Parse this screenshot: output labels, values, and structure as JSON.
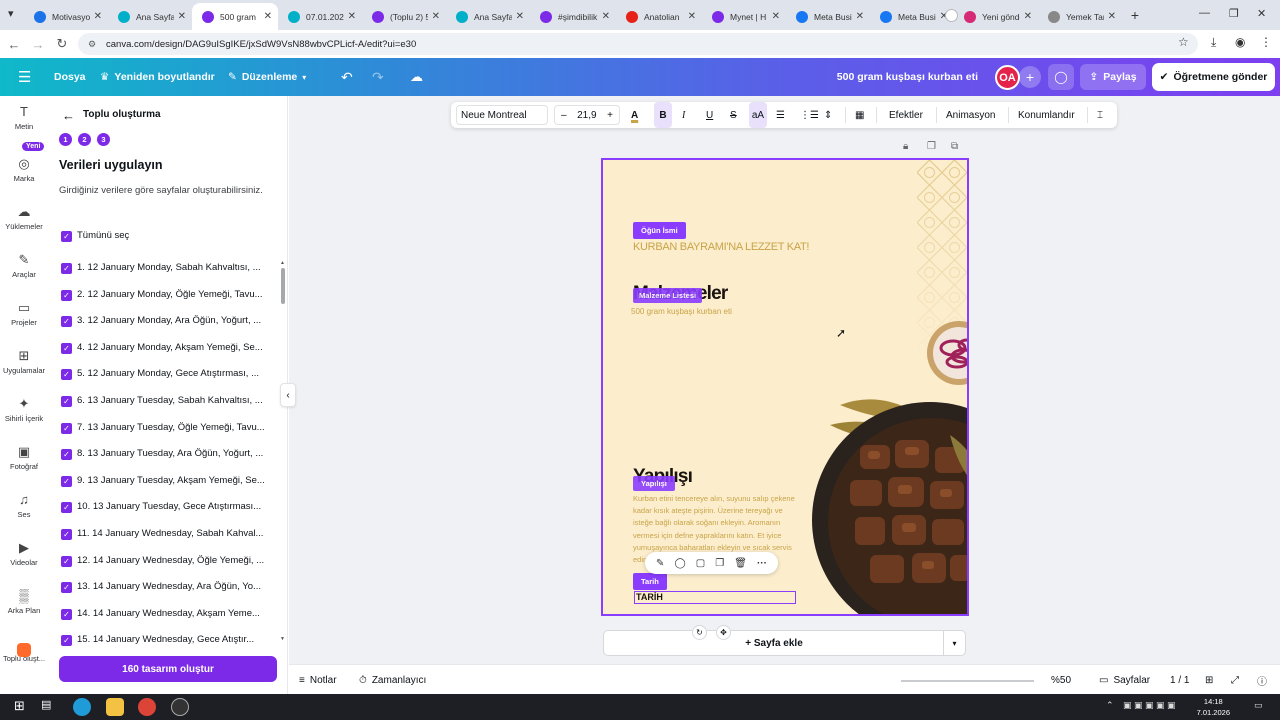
{
  "browser": {
    "tabs": [
      {
        "title": "Motivasyon",
        "color": "#1a73e8",
        "active": false
      },
      {
        "title": "Ana Sayfa",
        "color": "#00b0c8",
        "active": false
      },
      {
        "title": "500 gram",
        "color": "#7d2ae8",
        "active": true
      },
      {
        "title": "07.01.2026",
        "color": "#00b0c8",
        "active": false
      },
      {
        "title": "(Toplu 2) 5",
        "color": "#7d2ae8",
        "active": false
      },
      {
        "title": "Ana Sayfa",
        "color": "#00b0c8",
        "active": false
      },
      {
        "title": "#şimdibilik",
        "color": "#7d2ae8",
        "active": false
      },
      {
        "title": "Anatolian",
        "color": "#e62117",
        "active": false
      },
      {
        "title": "Mynet | H",
        "color": "#7d2ae8",
        "active": false
      },
      {
        "title": "Meta Busin",
        "color": "#1877f2",
        "active": false
      },
      {
        "title": "Meta Busin",
        "color": "#1877f2",
        "active": false
      },
      {
        "title": "Yeni göndc",
        "color": "#d62976",
        "active": false
      },
      {
        "title": "Yemek Tar",
        "color": "#888888",
        "active": false
      }
    ],
    "new_tab": "+",
    "url": "canva.com/design/DAG9uISgIKE/jxSdW9VsN88wbvCPLicf-A/edit?ui=e30"
  },
  "canva_header": {
    "menu_icon": "menu-icon",
    "file": "Dosya",
    "resize": "Yeniden boyutlandır",
    "editing": "Düzenleme",
    "project_title": "500 gram kuşbaşı kurban eti",
    "avatar_initials": "OA",
    "plus": "+",
    "share": "Paylaş",
    "send_to_teacher": "Öğretmene gönder"
  },
  "rail": {
    "new_badge": "Yeni",
    "items": [
      {
        "label": "Metin",
        "icon": "text-icon",
        "glyph": "T"
      },
      {
        "label": "Marka",
        "icon": "brand-icon",
        "glyph": "◎"
      },
      {
        "label": "Yüklemeler",
        "icon": "upload-icon",
        "glyph": "☁"
      },
      {
        "label": "Araçlar",
        "icon": "tools-icon",
        "glyph": "✎"
      },
      {
        "label": "Projeler",
        "icon": "folder-icon",
        "glyph": "▭"
      },
      {
        "label": "Uygulamalar",
        "icon": "apps-icon",
        "glyph": "⊞"
      },
      {
        "label": "Sihirli İçerik",
        "icon": "magic-icon",
        "glyph": "✦"
      },
      {
        "label": "Fotoğraf",
        "icon": "photo-icon",
        "glyph": "▣"
      },
      {
        "label": "Ses",
        "icon": "music-icon",
        "glyph": "♫"
      },
      {
        "label": "Videolar",
        "icon": "video-icon",
        "glyph": "▶"
      },
      {
        "label": "Arka Plan",
        "icon": "background-icon",
        "glyph": "▒"
      },
      {
        "label": "Toplu oluşt...",
        "icon": "bulk-create-icon",
        "glyph": ""
      }
    ]
  },
  "panel": {
    "title": "Toplu oluşturma",
    "steps": [
      "1",
      "2",
      "3"
    ],
    "heading": "Verileri uygulayın",
    "description": "Girdiğiniz verilere göre sayfalar oluşturabilirsiniz.",
    "select_all": "Tümünü seç",
    "check_glyph": "✓",
    "rows": [
      "1. 12 January Monday, Sabah Kahvaltısı, ...",
      "2. 12 January Monday, Öğle Yemeği, Tavu...",
      "3. 12 January Monday, Ara Öğün, Yoğurt, ...",
      "4. 12 January Monday, Akşam Yemeği, Se...",
      "5. 12 January Monday, Gece Atıştırması, ...",
      "6. 13 January Tuesday, Sabah Kahvaltısı, ...",
      "7. 13 January Tuesday, Öğle Yemeği, Tavu...",
      "8. 13 January Tuesday, Ara Öğün, Yoğurt, ...",
      "9. 13 January Tuesday, Akşam Yemeği, Se...",
      "10. 13 January Tuesday, Gece Atıştırması...",
      "11. 14 January Wednesday, Sabah Kahval...",
      "12. 14 January Wednesday, Öğle Yemeği, ...",
      "13. 14 January Wednesday, Ara Öğün, Yo...",
      "14. 14 January Wednesday, Akşam Yeme...",
      "15. 14 January Wednesday, Gece Atıştır..."
    ],
    "create_button": "160 tasarım oluştur"
  },
  "toolbar": {
    "font": "Neue Montreal",
    "minus": "–",
    "size": "21,9",
    "plus": "+",
    "bold": "B",
    "italic": "I",
    "underline": "U",
    "strike": "S",
    "case": "aA",
    "effects": "Efektler",
    "animation": "Animasyon",
    "position": "Konumlandır"
  },
  "design": {
    "tag_meal": "Öğün İsmi",
    "headline": "KURBAN BAYRAMI'NA LEZZET KAT!",
    "ingredients_heading": "Malzemeler",
    "tag_ingredients": "Malzeme Listesi",
    "ingredients_text": "500 gram kuşbaşı kurban eti",
    "method_heading": "Yapılışı",
    "tag_method": "Yapılışı",
    "method_text": "Kurban etini tencereye alın, suyunu salıp çekene kadar kısık ateşte pişirin. Üzerine tereyağı ve isteğe bağlı olarak soğanı ekleyin. Aromanın vermesi için defne yapraklarını katın. Et iyice yumuşayınca baharatları ekleyin ve sıcak servis edin.",
    "tag_date": "Tarih",
    "date_text": "TARİH"
  },
  "footer_canvas": {
    "add_page": "+ Sayfa ekle"
  },
  "bottombar": {
    "notes": "Notlar",
    "timer": "Zamanlayıcı",
    "zoom": "%50",
    "zoom_level": 0.38,
    "pages": "Sayfalar",
    "page_count": "1 / 1"
  },
  "taskbar": {
    "time": "14:18",
    "date": "7.01.2026"
  },
  "colors": {
    "accent": "#7d2ae8",
    "page_bg": "#fcedcd",
    "gold": "#c8a447"
  }
}
